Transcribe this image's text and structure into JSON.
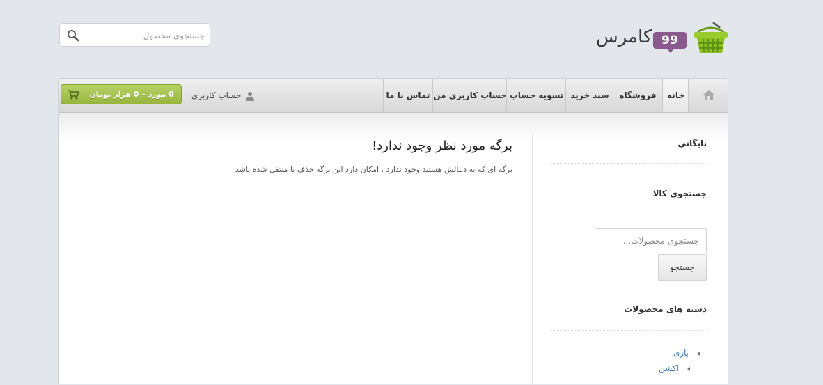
{
  "logo": {
    "text": "کامرس",
    "badge": "99"
  },
  "header_search": {
    "placeholder": "جستجوی محصول"
  },
  "nav": {
    "items": [
      {
        "label": "خانه",
        "active": true
      },
      {
        "label": "فروشگاه"
      },
      {
        "label": "سبد خرید"
      },
      {
        "label": "تسویه حساب"
      },
      {
        "label": "حساب کاربری من"
      },
      {
        "label": "تماس با ما"
      }
    ],
    "account_label": "حساب کاربری",
    "cart_label": "0 مورد – 0 هزار تومان"
  },
  "sidebar": {
    "archives_title": "بایگانی",
    "product_search_title": "جستجوی کالا",
    "search_placeholder": "جستجوی محصولات...",
    "search_button": "جستجو",
    "categories_title": "دسته های محصولات",
    "categories": [
      "بازی",
      "اکشن"
    ]
  },
  "main": {
    "title": "برگه مورد نظر وجود ندارد!",
    "text": "برگه ای که به دنبالش هستید وجود ندارد ، امکان دارد این برگه حذف یا منتقل شده باشد"
  },
  "colors": {
    "accent_green": "#a7c451",
    "badge_purple": "#8a5a8f",
    "link_blue": "#3b78b8"
  }
}
